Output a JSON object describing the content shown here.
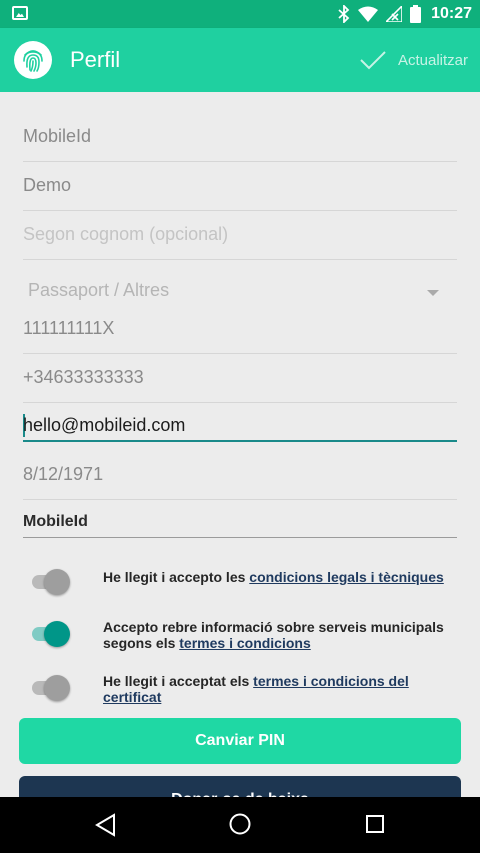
{
  "status_bar": {
    "time": "10:27",
    "icons": [
      "image-icon",
      "bluetooth-icon",
      "wifi-icon",
      "no-signal-icon",
      "battery-icon"
    ]
  },
  "app_bar": {
    "title": "Perfil",
    "update_label": "Actualitzar",
    "logo": "fingerprint-icon",
    "update_icon": "check-icon"
  },
  "form": {
    "first_name": "MobileId",
    "surname": "Demo",
    "second_surname_placeholder": "Segon cognom (opcional)",
    "document_type": "Passaport / Altres",
    "document_number": "111111111X",
    "phone": "+34633333333",
    "email": "hello@mobileid.com",
    "birth_date": "8/12/1971",
    "app_name": "MobileId"
  },
  "consents": [
    {
      "text": "He llegit i accepto les ",
      "link": "condicions legals i tècniques",
      "after": "",
      "enabled": false
    },
    {
      "text": "Accepto rebre informació sobre serveis municipals segons els ",
      "link": "termes i condicions",
      "after": "",
      "enabled": true
    },
    {
      "text": "He llegit i acceptat els ",
      "link": "termes i condicions del certificat",
      "after": "",
      "enabled": false
    }
  ],
  "buttons": {
    "change_pin": "Canviar PIN",
    "unsubscribe": "Donar-se de baixa"
  },
  "colors": {
    "status_bar": "#0fb07c",
    "app_bar": "#1fd0a0",
    "accent": "#009688",
    "primary_button": "#1fd8a4",
    "dark_button": "#1d3651"
  },
  "nav": [
    "back-icon",
    "home-icon",
    "recents-icon"
  ]
}
